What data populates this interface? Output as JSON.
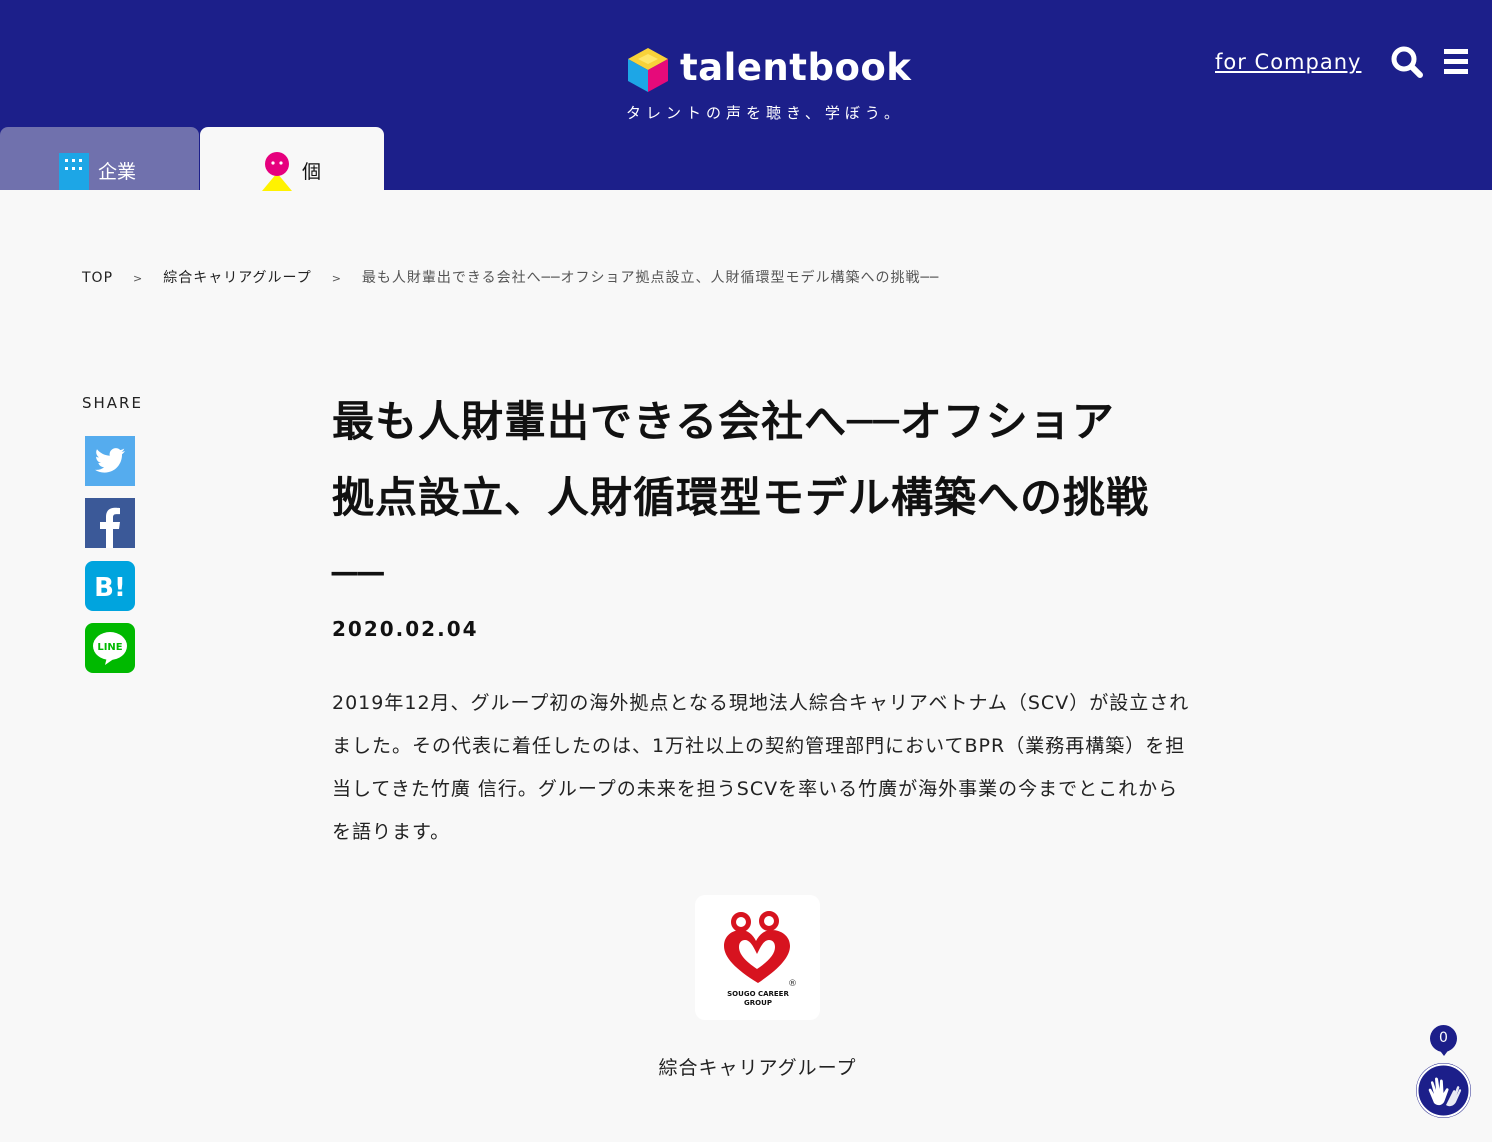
{
  "header": {
    "brand": "talentbook",
    "tagline": "タレントの声を聴き、学ぼう。",
    "for_company_link": "for Company",
    "bg_color": "#1c1f8a",
    "icons": [
      "search-icon",
      "hamburger-menu-icon"
    ]
  },
  "tabs": [
    {
      "label": "企業",
      "icon": "building-icon",
      "active": false
    },
    {
      "label": "個",
      "icon": "person-icon",
      "active": true
    }
  ],
  "breadcrumb": {
    "items": [
      "TOP",
      "綜合キャリアグループ",
      "最も人財輩出できる会社へ──オフショア拠点設立、人財循環型モデル構築への挑戦──"
    ],
    "separator": ">"
  },
  "share": {
    "label": "SHARE",
    "buttons": [
      {
        "name": "twitter",
        "icon": "twitter-icon",
        "color": "#55acee"
      },
      {
        "name": "facebook",
        "icon": "facebook-icon",
        "color": "#3b5998"
      },
      {
        "name": "hatena-bookmark",
        "icon": "hatena-bookmark-icon",
        "color": "#00a4de",
        "text": "B!"
      },
      {
        "name": "line",
        "icon": "line-icon",
        "color": "#00b900",
        "text": "LINE"
      }
    ]
  },
  "article": {
    "title_line1": "最も人財輩出できる会社へ──オフショア",
    "title_line2": "拠点設立、人財循環型モデル構築への挑戦",
    "title_line3": "──",
    "date": "2020.02.04",
    "lead": "2019年12月、グループ初の海外拠点となる現地法人綜合キャリアベトナム（SCV）が設立されました。その代表に着任したのは、1万社以上の契約管理部門においてBPR（業務再構築）を担当してきた竹廣 信行。グループの未来を担うSCVを率いる竹廣が海外事業の今までとこれからを語ります。"
  },
  "company": {
    "name": "綜合キャリアグループ",
    "logo_text_line1": "SOUGO CAREER",
    "logo_text_line2": "GROUP",
    "logo_mark": "®",
    "logo_color": "#d7131f"
  },
  "clap": {
    "count": "0",
    "icon": "clap-hands-icon"
  }
}
